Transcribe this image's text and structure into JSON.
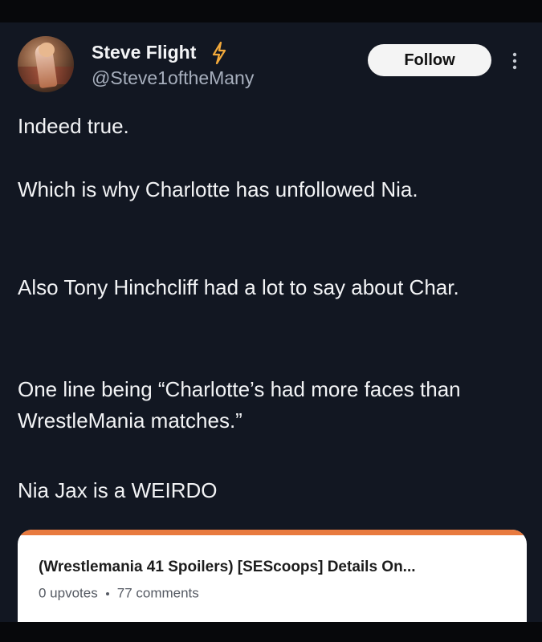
{
  "author": {
    "name": "Steve Flight",
    "handle": "@Steve1oftheMany",
    "verified_icon": "bolt-icon"
  },
  "actions": {
    "follow_label": "Follow",
    "more_icon": "more-vertical-icon"
  },
  "post": {
    "paragraphs": [
      "Indeed true.",
      "Which is why Charlotte has unfollowed Nia.",
      "Also Tony Hinchcliff had a lot to say about Char.",
      "One line being “Charlotte’s had more faces than WrestleMania matches.”",
      "Nia Jax is a WEIRDO"
    ]
  },
  "link_card": {
    "title": "(Wrestlemania 41 Spoilers) [SEScoops] Details On...",
    "upvotes": "0 upvotes",
    "comments": "77 comments",
    "accent_color": "#e87a3f"
  },
  "colors": {
    "background": "#121722",
    "text": "#f2f3f5",
    "muted": "#a7afbd",
    "button": "#f4f4f4",
    "bolt": "#f2a93b"
  }
}
